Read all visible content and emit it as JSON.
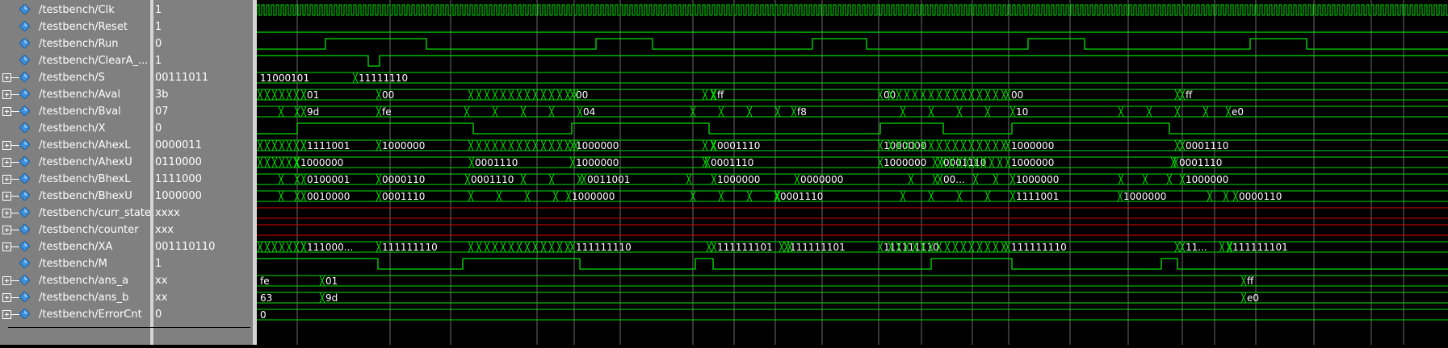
{
  "signals": [
    {
      "name": "/testbench/Clk",
      "value": "1",
      "bus": false
    },
    {
      "name": "/testbench/Reset",
      "value": "1",
      "bus": false
    },
    {
      "name": "/testbench/Run",
      "value": "0",
      "bus": false
    },
    {
      "name": "/testbench/ClearA_...",
      "value": "1",
      "bus": false
    },
    {
      "name": "/testbench/S",
      "value": "00111011",
      "bus": true
    },
    {
      "name": "/testbench/Aval",
      "value": "3b",
      "bus": true
    },
    {
      "name": "/testbench/Bval",
      "value": "07",
      "bus": true
    },
    {
      "name": "/testbench/X",
      "value": "0",
      "bus": false
    },
    {
      "name": "/testbench/AhexL",
      "value": "0000011",
      "bus": true
    },
    {
      "name": "/testbench/AhexU",
      "value": "0110000",
      "bus": true
    },
    {
      "name": "/testbench/BhexL",
      "value": "1111000",
      "bus": true
    },
    {
      "name": "/testbench/BhexU",
      "value": "1000000",
      "bus": true
    },
    {
      "name": "/testbench/curr_state",
      "value": "xxxx",
      "bus": true
    },
    {
      "name": "/testbench/counter",
      "value": "xxx",
      "bus": true
    },
    {
      "name": "/testbench/XA",
      "value": "001110110",
      "bus": true
    },
    {
      "name": "/testbench/M",
      "value": "1",
      "bus": false
    },
    {
      "name": "/testbench/ans_a",
      "value": "xx",
      "bus": true
    },
    {
      "name": "/testbench/ans_b",
      "value": "xx",
      "bus": true
    },
    {
      "name": "/testbench/ErrorCnt",
      "value": "0",
      "bus": true
    }
  ],
  "waves": {
    "gridlines": [
      50,
      165,
      240,
      347,
      393,
      450,
      540,
      591,
      642,
      700,
      770,
      823,
      886,
      931,
      1007,
      1079,
      1146,
      1186,
      1237,
      1309,
      1380,
      1420,
      1480
    ],
    "run_pulses": [
      [
        85,
        210
      ],
      [
        420,
        490
      ],
      [
        688,
        755
      ],
      [
        955,
        1025
      ],
      [
        1230,
        1300
      ]
    ],
    "clear_pulse": [
      138,
      152
    ],
    "x_segments": [
      [
        0,
        50,
        "low"
      ],
      [
        50,
        268,
        "high"
      ],
      [
        268,
        390,
        "low"
      ],
      [
        390,
        560,
        "high"
      ],
      [
        560,
        772,
        "low"
      ],
      [
        772,
        850,
        "high"
      ],
      [
        850,
        935,
        "low"
      ],
      [
        935,
        1130,
        "high"
      ],
      [
        1130,
        1475,
        "low"
      ]
    ],
    "m_segments": [
      [
        0,
        150,
        "high"
      ],
      [
        150,
        255,
        "low"
      ],
      [
        255,
        400,
        "high"
      ],
      [
        400,
        543,
        "low"
      ],
      [
        543,
        565,
        "high"
      ],
      [
        565,
        835,
        "low"
      ],
      [
        835,
        935,
        "high"
      ],
      [
        935,
        1120,
        "low"
      ],
      [
        1120,
        1140,
        "high"
      ],
      [
        1140,
        1475,
        "low"
      ]
    ],
    "bus_labels": {
      "S": [
        [
          4,
          "11000101"
        ],
        [
          126,
          "11111110"
        ]
      ],
      "Aval": [
        [
          62,
          "01"
        ],
        [
          155,
          "00"
        ],
        [
          395,
          "00"
        ],
        [
          570,
          "ff"
        ],
        [
          776,
          "00"
        ],
        [
          934,
          "00"
        ],
        [
          1150,
          "ff"
        ]
      ],
      "Bval": [
        [
          62,
          "9d"
        ],
        [
          155,
          "fe"
        ],
        [
          404,
          "04"
        ],
        [
          669,
          "f8"
        ],
        [
          940,
          "10"
        ],
        [
          1207,
          "e0"
        ]
      ],
      "AhexL": [
        [
          62,
          "1111001"
        ],
        [
          155,
          "1000000"
        ],
        [
          395,
          "1000000"
        ],
        [
          570,
          "0001110"
        ],
        [
          776,
          "1000000"
        ],
        [
          934,
          "1000000"
        ],
        [
          1150,
          "0001110"
        ]
      ],
      "AhexU": [
        [
          54,
          "1000000"
        ],
        [
          270,
          "0001110"
        ],
        [
          395,
          "1000000"
        ],
        [
          562,
          "0001110"
        ],
        [
          776,
          "1000000"
        ],
        [
          850,
          "0001110"
        ],
        [
          934,
          "1000000"
        ],
        [
          1142,
          "0001110"
        ]
      ],
      "BhexL": [
        [
          62,
          "0100001"
        ],
        [
          155,
          "0000110"
        ],
        [
          265,
          "0001110"
        ],
        [
          409,
          "0011001"
        ],
        [
          570,
          "1000000"
        ],
        [
          673,
          "0000000"
        ],
        [
          850,
          "00..."
        ],
        [
          940,
          "1000000"
        ],
        [
          1150,
          "1000000"
        ]
      ],
      "BhexU": [
        [
          62,
          "0010000"
        ],
        [
          155,
          "0001110"
        ],
        [
          390,
          "1000000"
        ],
        [
          648,
          "0001110"
        ],
        [
          940,
          "1111001"
        ],
        [
          1073,
          "1000000"
        ],
        [
          1216,
          "0000110"
        ]
      ],
      "XA": [
        [
          62,
          "111000..."
        ],
        [
          155,
          "111111110"
        ],
        [
          395,
          "111111110"
        ],
        [
          570,
          "111111101"
        ],
        [
          660,
          "111111101"
        ],
        [
          776,
          "111111110"
        ],
        [
          934,
          "111111110"
        ],
        [
          1150,
          "11..."
        ],
        [
          1208,
          "111111101"
        ]
      ],
      "ans_a": [
        [
          4,
          "fe"
        ],
        [
          85,
          "01"
        ],
        [
          1226,
          "ff"
        ]
      ],
      "ans_b": [
        [
          4,
          "63"
        ],
        [
          85,
          "9d"
        ],
        [
          1226,
          "e0"
        ]
      ],
      "ErrorCnt": [
        [
          4,
          "0"
        ]
      ]
    },
    "colors": {
      "wave": "#00e000",
      "undefined": "#e00000",
      "grid": "#6a6a6a",
      "bg": "#000000",
      "pane": "#808080"
    }
  }
}
